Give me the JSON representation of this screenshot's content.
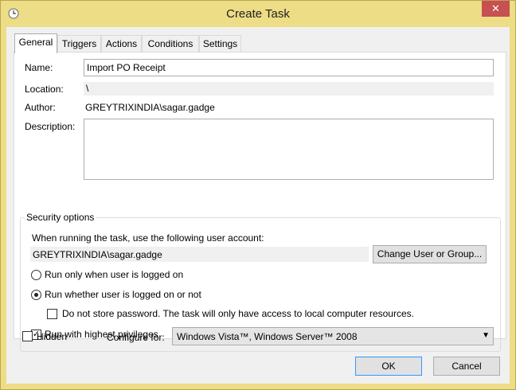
{
  "window": {
    "title": "Create Task"
  },
  "tabs": [
    {
      "label": "General"
    },
    {
      "label": "Triggers"
    },
    {
      "label": "Actions"
    },
    {
      "label": "Conditions"
    },
    {
      "label": "Settings"
    }
  ],
  "general": {
    "name_label": "Name:",
    "name_value": "Import PO Receipt",
    "location_label": "Location:",
    "location_value": "\\",
    "author_label": "Author:",
    "author_value": "GREYTRIXINDIA\\sagar.gadge",
    "description_label": "Description:",
    "description_value": ""
  },
  "security": {
    "title": "Security options",
    "account_prompt": "When running the task, use the following user account:",
    "account_value": "GREYTRIXINDIA\\sagar.gadge",
    "change_button": "Change User or Group...",
    "radio_logged_on": "Run only when user is logged on",
    "radio_whether": "Run whether user is logged on or not",
    "selected_radio": "whether",
    "no_store_password": "Do not store password.  The task will only have access to local computer resources.",
    "no_store_checked": false,
    "highest_privileges": "Run with highest privileges",
    "highest_checked": true
  },
  "bottom": {
    "hidden_label": "Hidden",
    "hidden_checked": false,
    "configure_label": "Configure for:",
    "configure_value": "Windows Vista™, Windows Server™ 2008"
  },
  "buttons": {
    "ok": "OK",
    "cancel": "Cancel"
  },
  "colors": {
    "frame": "#ecdd86",
    "close": "#c75050",
    "default_border": "#3399ff"
  }
}
